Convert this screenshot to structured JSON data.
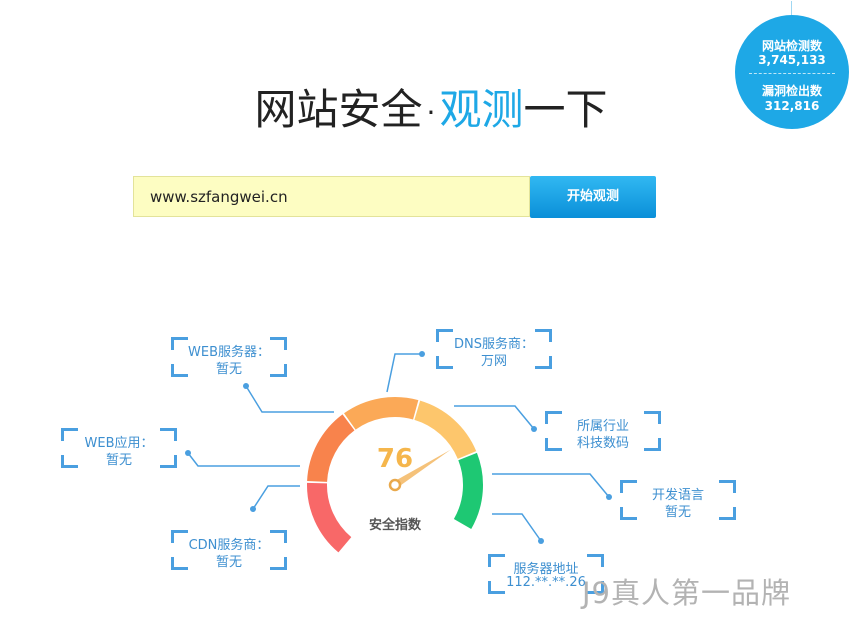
{
  "stats": {
    "sites_label": "网站检测数",
    "sites_value": "3,745,133",
    "vulns_label": "漏洞检出数",
    "vulns_value": "312,816"
  },
  "header": {
    "title_part1": "网站安全",
    "title_dot": "·",
    "title_accent": "观测",
    "title_part2": "一下"
  },
  "search": {
    "value": "www.szfangwei.cn",
    "button_label": "开始观测"
  },
  "gauge": {
    "score": 76,
    "label": "安全指数",
    "segment_colors": [
      "#f86868",
      "#f8834c",
      "#fba957",
      "#fdc66c",
      "#1ec873"
    ]
  },
  "info": {
    "web_server": {
      "label": "WEB服务器：",
      "value": "暂无"
    },
    "dns_provider": {
      "label": "DNS服务商：",
      "value": "万网"
    },
    "web_app": {
      "label": "WEB应用：",
      "value": "暂无"
    },
    "industry": {
      "label": "所属行业",
      "value": "科技数码"
    },
    "language": {
      "label": "开发语言",
      "value": "暂无"
    },
    "cdn_provider": {
      "label": "CDN服务商：",
      "value": "暂无"
    },
    "server_ip": {
      "label": "服务器地址",
      "value": "112.**.**.26"
    }
  },
  "watermark": "J9真人第一品牌"
}
